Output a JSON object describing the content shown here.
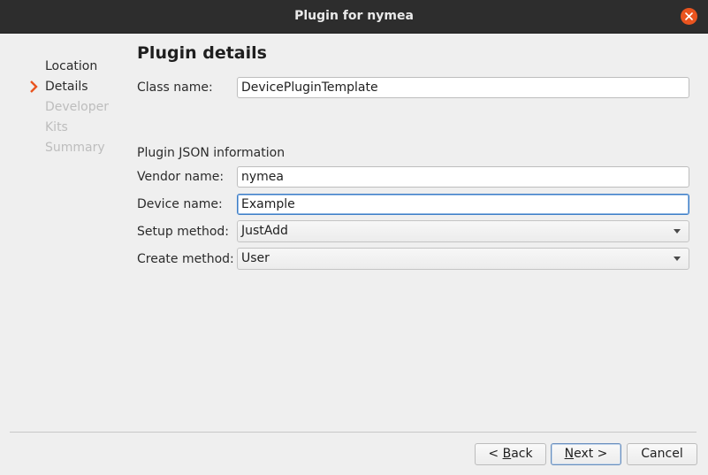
{
  "window": {
    "title": "Plugin for nymea"
  },
  "steps": [
    {
      "label": "Location",
      "state": "done"
    },
    {
      "label": "Details",
      "state": "active"
    },
    {
      "label": "Developer",
      "state": "pending"
    },
    {
      "label": "Kits",
      "state": "pending"
    },
    {
      "label": "Summary",
      "state": "pending"
    }
  ],
  "page": {
    "title": "Plugin details",
    "class_name_label": "Class name:",
    "class_name_value": "DevicePluginTemplate",
    "json_section_label": "Plugin JSON information",
    "vendor_label": "Vendor name:",
    "vendor_value": "nymea",
    "device_label": "Device name:",
    "device_value": "Example",
    "setup_label": "Setup method:",
    "setup_value": "JustAdd",
    "create_label": "Create method:",
    "create_value": "User"
  },
  "buttons": {
    "back_prefix": "< ",
    "back_mnemonic": "B",
    "back_rest": "ack",
    "next_mnemonic": "N",
    "next_rest": "ext >",
    "cancel": "Cancel"
  },
  "colors": {
    "titlebar": "#2d2d2d",
    "close_button": "#e9541f",
    "active_arrow": "#e9541f",
    "window_bg": "#efefef"
  }
}
